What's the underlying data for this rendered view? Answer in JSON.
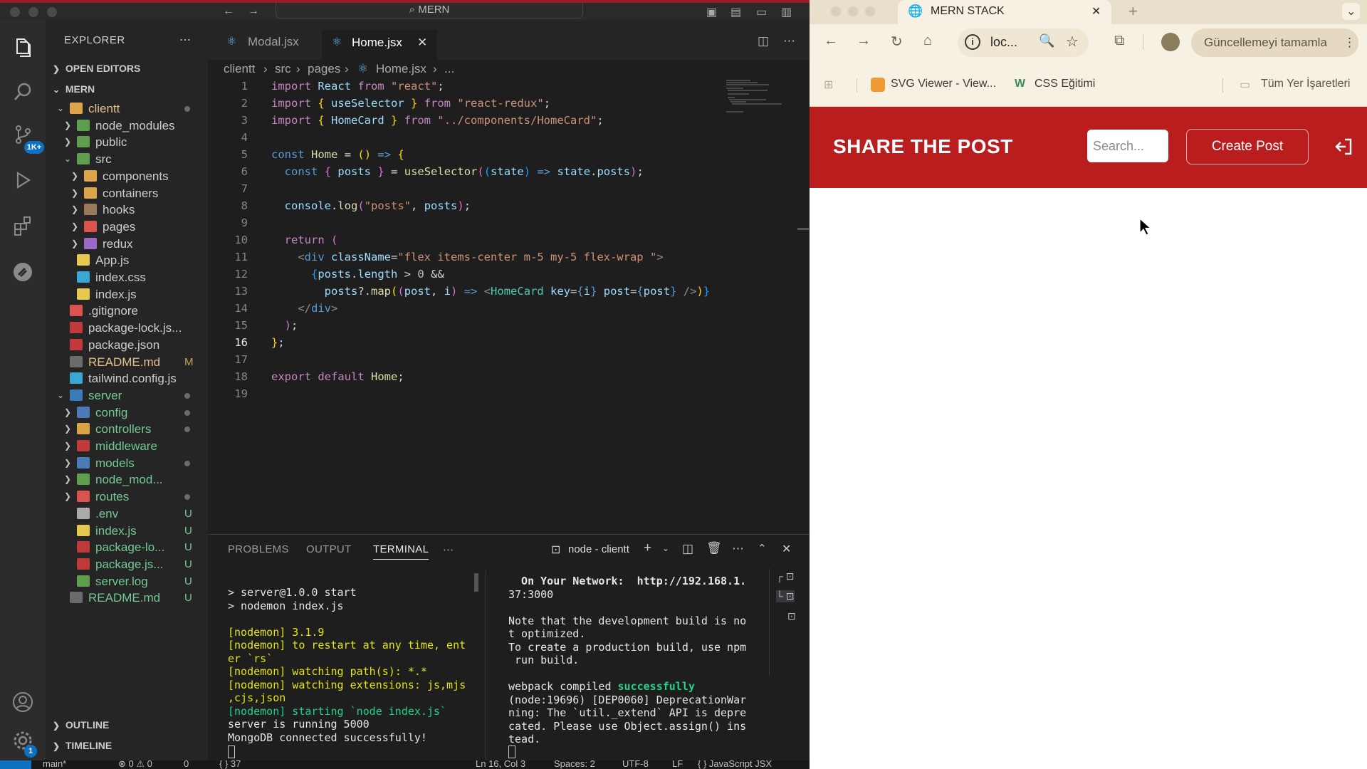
{
  "vscode": {
    "title": "MERN",
    "activity_badges": {
      "scm": "1K+",
      "settings": "1"
    },
    "explorer": {
      "header": "EXPLORER",
      "open_editors": "OPEN EDITORS",
      "root": "MERN",
      "outline": "OUTLINE",
      "timeline": "TIMELINE",
      "tree": [
        {
          "name": "clientt",
          "status": ""
        },
        {
          "name": "node_modules",
          "status": ""
        },
        {
          "name": "public",
          "status": ""
        },
        {
          "name": "src",
          "status": ""
        },
        {
          "name": "components",
          "status": ""
        },
        {
          "name": "containers",
          "status": ""
        },
        {
          "name": "hooks",
          "status": ""
        },
        {
          "name": "pages",
          "status": ""
        },
        {
          "name": "redux",
          "status": ""
        },
        {
          "name": "App.js",
          "status": ""
        },
        {
          "name": "index.css",
          "status": ""
        },
        {
          "name": "index.js",
          "status": ""
        },
        {
          "name": ".gitignore",
          "status": ""
        },
        {
          "name": "package-lock.js...",
          "status": ""
        },
        {
          "name": "package.json",
          "status": ""
        },
        {
          "name": "README.md",
          "status": "M"
        },
        {
          "name": "tailwind.config.js",
          "status": ""
        },
        {
          "name": "server",
          "status": ""
        },
        {
          "name": "config",
          "status": ""
        },
        {
          "name": "controllers",
          "status": ""
        },
        {
          "name": "middleware",
          "status": ""
        },
        {
          "name": "models",
          "status": ""
        },
        {
          "name": "node_mod...",
          "status": ""
        },
        {
          "name": "routes",
          "status": ""
        },
        {
          "name": ".env",
          "status": "U"
        },
        {
          "name": "index.js",
          "status": "U"
        },
        {
          "name": "package-lo...",
          "status": "U"
        },
        {
          "name": "package.js...",
          "status": "U"
        },
        {
          "name": "server.log",
          "status": "U"
        },
        {
          "name": "README.md",
          "status": "U"
        }
      ]
    },
    "tabs": [
      {
        "label": "Modal.jsx"
      },
      {
        "label": "Home.jsx"
      }
    ],
    "breadcrumb": [
      "clientt",
      "src",
      "pages",
      "Home.jsx",
      "..."
    ],
    "line_numbers": [
      "1",
      "2",
      "3",
      "4",
      "5",
      "6",
      "7",
      "8",
      "9",
      "10",
      "11",
      "12",
      "13",
      "14",
      "15",
      "16",
      "17",
      "18",
      "19"
    ],
    "code": {
      "l1": [
        "import",
        "React",
        "from",
        "\"react\"",
        ";"
      ],
      "l2": [
        "import",
        "{ ",
        "useSelector",
        " }",
        "from",
        "\"react-redux\"",
        ";"
      ],
      "l3": [
        "import",
        "{ ",
        "HomeCard",
        " }",
        "from",
        "\"../components/HomeCard\"",
        ";"
      ],
      "l5": [
        "const",
        "Home",
        "=",
        "()",
        "=>",
        "{"
      ],
      "l6": [
        "const",
        "{ ",
        "posts",
        " }",
        "=",
        "useSelector",
        "(",
        "(",
        "state",
        ")",
        "=>",
        "state",
        ".",
        "posts",
        ")",
        ";"
      ],
      "l8": [
        "console",
        ".",
        "log",
        "(",
        "\"posts\"",
        ", ",
        "posts",
        ")",
        ";"
      ],
      "l10": [
        "return",
        "("
      ],
      "l11": [
        "<",
        "div",
        "className",
        "=",
        "\"flex items-center m-5 my-5 flex-wrap \"",
        ">"
      ],
      "l12": [
        "{",
        "posts",
        ".",
        "length",
        " > ",
        "0",
        " &&"
      ],
      "l13": [
        "posts",
        "?.",
        "map",
        "(",
        "(",
        "post",
        ", ",
        "i",
        ")",
        " => ",
        "<",
        "HomeCard",
        " key",
        "=",
        "{",
        "i",
        "}",
        " post",
        "=",
        "{",
        "post",
        "}",
        " />",
        ")",
        "}"
      ],
      "l14": [
        "</",
        "div",
        ">"
      ],
      "l15": [
        ")",
        ";"
      ],
      "l16": [
        "}",
        ";"
      ],
      "l18": [
        "export",
        "default",
        "Home",
        ";"
      ]
    },
    "panel": {
      "tabs": [
        "PROBLEMS",
        "OUTPUT",
        "TERMINAL"
      ],
      "terminal_name": "node - clientt",
      "left_terminal": [
        "> server@1.0.0 start",
        "> nodemon index.js",
        "",
        "[nodemon] 3.1.9",
        "[nodemon] to restart at any time, ent",
        "er `rs`",
        "[nodemon] watching path(s): *.*",
        "[nodemon] watching extensions: js,mjs",
        ",cjs,json",
        "[nodemon] starting `node index.js`",
        "server is running 5000",
        "MongoDB connected successfully!"
      ],
      "right_terminal": [
        "  On Your Network:  http://192.168.1.",
        "37:3000",
        "",
        "Note that the development build is no",
        "t optimized.",
        "To create a production build, use npm",
        " run build.",
        "",
        "webpack compiled successfully",
        "(node:19696) [DEP0060] DeprecationWar",
        "ning: The `util._extend` API is depre",
        "cated. Please use Object.assign() ins",
        "tead."
      ]
    },
    "status": {
      "branch": "main*",
      "problems": "⊗ 0 ⚠ 0",
      "ports": "0",
      "braces": "{ } 37",
      "cursor": "Ln 16, Col 3",
      "spaces": "Spaces: 2",
      "encoding": "UTF-8",
      "eol": "LF",
      "language": "{ } JavaScript JSX"
    }
  },
  "browser": {
    "tab_title": "MERN STACK",
    "address": "loc...",
    "update_label": "Güncellemeyi tamamla",
    "bookmarks": [
      "SVG Viewer - View...",
      "CSS Eğitimi",
      "Tüm Yer İşaretleri"
    ]
  },
  "site": {
    "logo": "SHARE THE POST",
    "search_placeholder": "Search...",
    "create_label": "Create Post",
    "colors": {
      "header": "#b91d1d",
      "text": "#ffffff"
    }
  }
}
